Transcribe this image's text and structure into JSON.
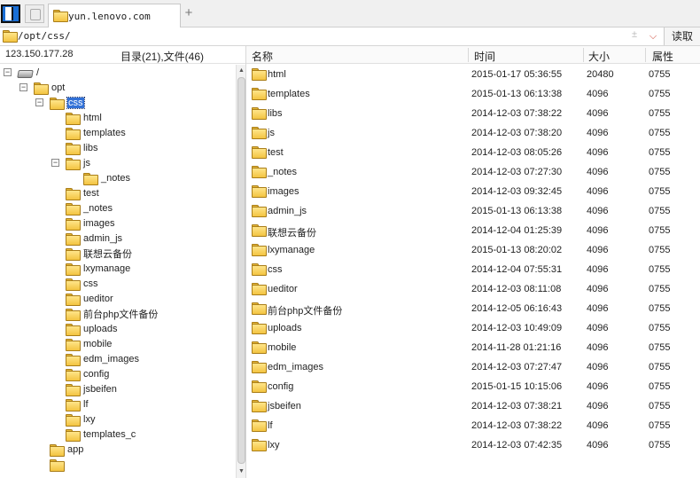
{
  "tab": {
    "title": "yun.lenovo.com",
    "add_label": "+"
  },
  "pathbar": {
    "path": "/opt/css/",
    "extra": "±",
    "chevron": "⌵",
    "read_label": "读取"
  },
  "left": {
    "ip": "123.150.177.28",
    "counts": "目录(21),文件(46)",
    "tree": [
      {
        "label": "/",
        "depth": 0,
        "expander": "⊟",
        "icon": "drive-icon"
      },
      {
        "label": "opt",
        "depth": 1,
        "expander": "⊟",
        "icon": "folder-icon"
      },
      {
        "label": "css",
        "depth": 2,
        "expander": "⊟",
        "icon": "folder-open-icon",
        "selected": true
      },
      {
        "label": "html",
        "depth": 3,
        "icon": "folder-icon"
      },
      {
        "label": "templates",
        "depth": 3,
        "icon": "folder-icon"
      },
      {
        "label": "libs",
        "depth": 3,
        "icon": "folder-icon"
      },
      {
        "label": "js",
        "depth": 3,
        "expander": "⊟",
        "icon": "folder-open-icon"
      },
      {
        "label": "_notes",
        "depth": 4,
        "icon": "folder-icon"
      },
      {
        "label": "test",
        "depth": 3,
        "icon": "folder-icon"
      },
      {
        "label": "_notes",
        "depth": 3,
        "icon": "folder-icon"
      },
      {
        "label": "images",
        "depth": 3,
        "icon": "folder-icon"
      },
      {
        "label": "admin_js",
        "depth": 3,
        "icon": "folder-icon"
      },
      {
        "label": "联想云备份",
        "depth": 3,
        "icon": "folder-icon"
      },
      {
        "label": "lxymanage",
        "depth": 3,
        "icon": "folder-icon"
      },
      {
        "label": "css",
        "depth": 3,
        "icon": "folder-icon"
      },
      {
        "label": "ueditor",
        "depth": 3,
        "icon": "folder-icon"
      },
      {
        "label": "前台php文件备份",
        "depth": 3,
        "icon": "folder-icon"
      },
      {
        "label": "uploads",
        "depth": 3,
        "icon": "folder-icon"
      },
      {
        "label": "mobile",
        "depth": 3,
        "icon": "folder-icon"
      },
      {
        "label": "edm_images",
        "depth": 3,
        "icon": "folder-icon"
      },
      {
        "label": "config",
        "depth": 3,
        "icon": "folder-icon"
      },
      {
        "label": "jsbeifen",
        "depth": 3,
        "icon": "folder-icon"
      },
      {
        "label": "lf",
        "depth": 3,
        "icon": "folder-icon"
      },
      {
        "label": "lxy",
        "depth": 3,
        "icon": "folder-icon"
      },
      {
        "label": "templates_c",
        "depth": 3,
        "icon": "folder-icon"
      },
      {
        "label": "app",
        "depth": 2,
        "icon": "folder-icon"
      },
      {
        "label": "",
        "depth": 2,
        "icon": "folder-icon"
      }
    ]
  },
  "table": {
    "columns": {
      "name": "名称",
      "time": "时间",
      "size": "大小",
      "perm": "属性"
    },
    "rows": [
      {
        "name": "html",
        "time": "2015-01-17 05:36:55",
        "size": "20480",
        "perm": "0755"
      },
      {
        "name": "templates",
        "time": "2015-01-13 06:13:38",
        "size": "4096",
        "perm": "0755"
      },
      {
        "name": "libs",
        "time": "2014-12-03 07:38:22",
        "size": "4096",
        "perm": "0755"
      },
      {
        "name": "js",
        "time": "2014-12-03 07:38:20",
        "size": "4096",
        "perm": "0755"
      },
      {
        "name": "test",
        "time": "2014-12-03 08:05:26",
        "size": "4096",
        "perm": "0755"
      },
      {
        "name": "_notes",
        "time": "2014-12-03 07:27:30",
        "size": "4096",
        "perm": "0755"
      },
      {
        "name": "images",
        "time": "2014-12-03 09:32:45",
        "size": "4096",
        "perm": "0755"
      },
      {
        "name": "admin_js",
        "time": "2015-01-13 06:13:38",
        "size": "4096",
        "perm": "0755"
      },
      {
        "name": "联想云备份",
        "time": "2014-12-04 01:25:39",
        "size": "4096",
        "perm": "0755"
      },
      {
        "name": "lxymanage",
        "time": "2015-01-13 08:20:02",
        "size": "4096",
        "perm": "0755"
      },
      {
        "name": "css",
        "time": "2014-12-04 07:55:31",
        "size": "4096",
        "perm": "0755"
      },
      {
        "name": "ueditor",
        "time": "2014-12-03 08:11:08",
        "size": "4096",
        "perm": "0755"
      },
      {
        "name": "前台php文件备份",
        "time": "2014-12-05 06:16:43",
        "size": "4096",
        "perm": "0755"
      },
      {
        "name": "uploads",
        "time": "2014-12-03 10:49:09",
        "size": "4096",
        "perm": "0755"
      },
      {
        "name": "mobile",
        "time": "2014-11-28 01:21:16",
        "size": "4096",
        "perm": "0755"
      },
      {
        "name": "edm_images",
        "time": "2014-12-03 07:27:47",
        "size": "4096",
        "perm": "0755"
      },
      {
        "name": "config",
        "time": "2015-01-15 10:15:06",
        "size": "4096",
        "perm": "0755"
      },
      {
        "name": "jsbeifen",
        "time": "2014-12-03 07:38:21",
        "size": "4096",
        "perm": "0755"
      },
      {
        "name": "lf",
        "time": "2014-12-03 07:38:22",
        "size": "4096",
        "perm": "0755"
      },
      {
        "name": "lxy",
        "time": "2014-12-03 07:42:35",
        "size": "4096",
        "perm": "0755"
      }
    ]
  },
  "colors": {
    "selection": "#3271d7",
    "folder": "#f3c441"
  }
}
